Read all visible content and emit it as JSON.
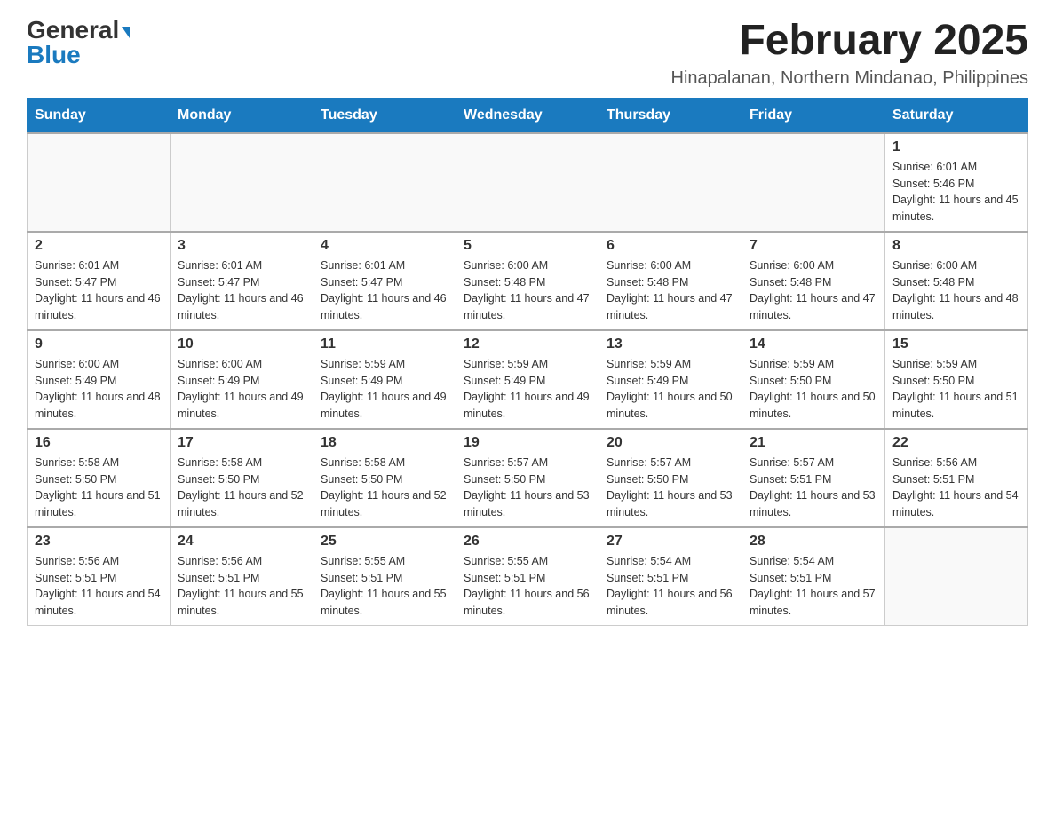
{
  "logo": {
    "text_general": "General",
    "text_blue": "Blue",
    "arrow": "▶"
  },
  "header": {
    "month_title": "February 2025",
    "location": "Hinapalanan, Northern Mindanao, Philippines"
  },
  "weekdays": [
    "Sunday",
    "Monday",
    "Tuesday",
    "Wednesday",
    "Thursday",
    "Friday",
    "Saturday"
  ],
  "weeks": [
    [
      {
        "day": "",
        "info": ""
      },
      {
        "day": "",
        "info": ""
      },
      {
        "day": "",
        "info": ""
      },
      {
        "day": "",
        "info": ""
      },
      {
        "day": "",
        "info": ""
      },
      {
        "day": "",
        "info": ""
      },
      {
        "day": "1",
        "info": "Sunrise: 6:01 AM\nSunset: 5:46 PM\nDaylight: 11 hours and 45 minutes."
      }
    ],
    [
      {
        "day": "2",
        "info": "Sunrise: 6:01 AM\nSunset: 5:47 PM\nDaylight: 11 hours and 46 minutes."
      },
      {
        "day": "3",
        "info": "Sunrise: 6:01 AM\nSunset: 5:47 PM\nDaylight: 11 hours and 46 minutes."
      },
      {
        "day": "4",
        "info": "Sunrise: 6:01 AM\nSunset: 5:47 PM\nDaylight: 11 hours and 46 minutes."
      },
      {
        "day": "5",
        "info": "Sunrise: 6:00 AM\nSunset: 5:48 PM\nDaylight: 11 hours and 47 minutes."
      },
      {
        "day": "6",
        "info": "Sunrise: 6:00 AM\nSunset: 5:48 PM\nDaylight: 11 hours and 47 minutes."
      },
      {
        "day": "7",
        "info": "Sunrise: 6:00 AM\nSunset: 5:48 PM\nDaylight: 11 hours and 47 minutes."
      },
      {
        "day": "8",
        "info": "Sunrise: 6:00 AM\nSunset: 5:48 PM\nDaylight: 11 hours and 48 minutes."
      }
    ],
    [
      {
        "day": "9",
        "info": "Sunrise: 6:00 AM\nSunset: 5:49 PM\nDaylight: 11 hours and 48 minutes."
      },
      {
        "day": "10",
        "info": "Sunrise: 6:00 AM\nSunset: 5:49 PM\nDaylight: 11 hours and 49 minutes."
      },
      {
        "day": "11",
        "info": "Sunrise: 5:59 AM\nSunset: 5:49 PM\nDaylight: 11 hours and 49 minutes."
      },
      {
        "day": "12",
        "info": "Sunrise: 5:59 AM\nSunset: 5:49 PM\nDaylight: 11 hours and 49 minutes."
      },
      {
        "day": "13",
        "info": "Sunrise: 5:59 AM\nSunset: 5:49 PM\nDaylight: 11 hours and 50 minutes."
      },
      {
        "day": "14",
        "info": "Sunrise: 5:59 AM\nSunset: 5:50 PM\nDaylight: 11 hours and 50 minutes."
      },
      {
        "day": "15",
        "info": "Sunrise: 5:59 AM\nSunset: 5:50 PM\nDaylight: 11 hours and 51 minutes."
      }
    ],
    [
      {
        "day": "16",
        "info": "Sunrise: 5:58 AM\nSunset: 5:50 PM\nDaylight: 11 hours and 51 minutes."
      },
      {
        "day": "17",
        "info": "Sunrise: 5:58 AM\nSunset: 5:50 PM\nDaylight: 11 hours and 52 minutes."
      },
      {
        "day": "18",
        "info": "Sunrise: 5:58 AM\nSunset: 5:50 PM\nDaylight: 11 hours and 52 minutes."
      },
      {
        "day": "19",
        "info": "Sunrise: 5:57 AM\nSunset: 5:50 PM\nDaylight: 11 hours and 53 minutes."
      },
      {
        "day": "20",
        "info": "Sunrise: 5:57 AM\nSunset: 5:50 PM\nDaylight: 11 hours and 53 minutes."
      },
      {
        "day": "21",
        "info": "Sunrise: 5:57 AM\nSunset: 5:51 PM\nDaylight: 11 hours and 53 minutes."
      },
      {
        "day": "22",
        "info": "Sunrise: 5:56 AM\nSunset: 5:51 PM\nDaylight: 11 hours and 54 minutes."
      }
    ],
    [
      {
        "day": "23",
        "info": "Sunrise: 5:56 AM\nSunset: 5:51 PM\nDaylight: 11 hours and 54 minutes."
      },
      {
        "day": "24",
        "info": "Sunrise: 5:56 AM\nSunset: 5:51 PM\nDaylight: 11 hours and 55 minutes."
      },
      {
        "day": "25",
        "info": "Sunrise: 5:55 AM\nSunset: 5:51 PM\nDaylight: 11 hours and 55 minutes."
      },
      {
        "day": "26",
        "info": "Sunrise: 5:55 AM\nSunset: 5:51 PM\nDaylight: 11 hours and 56 minutes."
      },
      {
        "day": "27",
        "info": "Sunrise: 5:54 AM\nSunset: 5:51 PM\nDaylight: 11 hours and 56 minutes."
      },
      {
        "day": "28",
        "info": "Sunrise: 5:54 AM\nSunset: 5:51 PM\nDaylight: 11 hours and 57 minutes."
      },
      {
        "day": "",
        "info": ""
      }
    ]
  ]
}
